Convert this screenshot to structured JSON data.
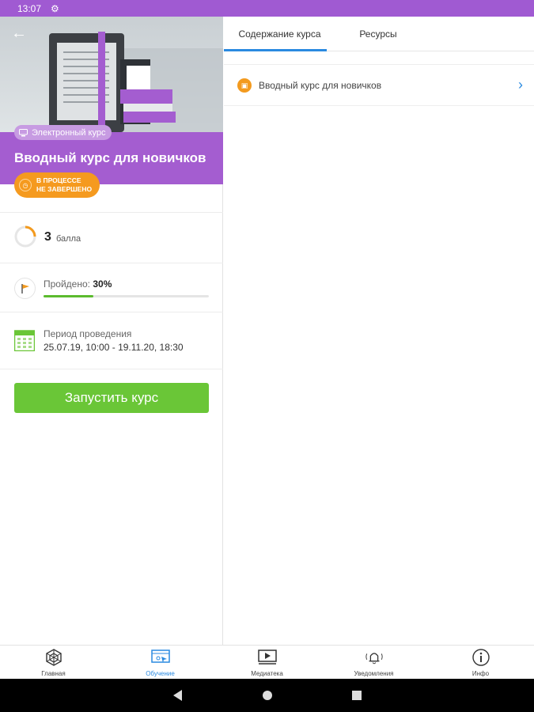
{
  "status_bar": {
    "time": "13:07"
  },
  "course": {
    "type_badge": "Электронный курс",
    "title": "Вводный курс для новичков",
    "status_line1": "В ПРОЦЕССЕ",
    "status_line2": "НЕ ЗАВЕРШЕНО",
    "points_value": "3",
    "points_unit": "балла",
    "progress_label": "Пройдено:",
    "progress_value": "30%",
    "progress_fraction": 0.3,
    "period_label": "Период проведения",
    "period_value": "25.07.19, 10:00 - 19.11.20, 18:30",
    "launch_label": "Запустить курс"
  },
  "tabs": [
    {
      "label": "Содержание курса",
      "active": true
    },
    {
      "label": "Ресурсы",
      "active": false
    }
  ],
  "content_items": [
    {
      "label": "Вводный курс для новичков",
      "icon": "course-module-icon"
    }
  ],
  "bottom_nav": [
    {
      "label": "Главная",
      "icon": "home-icon",
      "active": false
    },
    {
      "label": "Обучение",
      "icon": "learning-icon",
      "active": true
    },
    {
      "label": "Медиатека",
      "icon": "media-library-icon",
      "active": false
    },
    {
      "label": "Уведомления",
      "icon": "notifications-icon",
      "active": false
    },
    {
      "label": "Инфо",
      "icon": "info-icon",
      "active": false
    }
  ],
  "colors": {
    "accent_purple": "#a45dd0",
    "status_orange": "#f59a1f",
    "primary_green": "#6ac637",
    "tab_blue": "#2a8ae0"
  }
}
